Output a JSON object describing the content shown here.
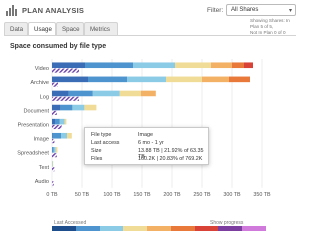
{
  "header": {
    "title": "PLAN ANALYSIS",
    "filter_label": "Filter:",
    "filter_value": "All Shares",
    "showing_line1": "Showing Shares: In Plan 5 of 5,",
    "showing_line2": "Not In Plan 0 of 0"
  },
  "tabs": [
    {
      "label": "Data"
    },
    {
      "label": "Usage"
    },
    {
      "label": "Space"
    },
    {
      "label": "Metrics"
    }
  ],
  "active_tab": "Usage",
  "section_title": "Space consumed by file type",
  "tooltip": {
    "rows": [
      {
        "key": "File type",
        "value": "Image"
      },
      {
        "key": "Last access",
        "value": "6 mo - 1 yr"
      },
      {
        "key": "Size",
        "value": "13.88 TB | 21.92% of 63.35 TB"
      },
      {
        "key": "Files",
        "value": "160.2K | 20.83% of 769.2K"
      }
    ]
  },
  "legend": {
    "left_label": "Last Accessed",
    "right_label": "Show progress",
    "colors": [
      "#1f4e8c",
      "#4e94cf",
      "#8ccbe6",
      "#f0dc96",
      "#f3b165",
      "#e8793b",
      "#d94237",
      "#7c3fa0",
      "#d07adb"
    ]
  },
  "chart_data": {
    "type": "bar",
    "orientation": "horizontal",
    "stacked": true,
    "categories": [
      "Video",
      "Archive",
      "Log",
      "Document",
      "Presentation",
      "Image",
      "Spreadsheet",
      "Text",
      "Audio"
    ],
    "x_ticks": [
      "0 TB",
      "50 TB",
      "100 TB",
      "150 TB",
      "200 TB",
      "250 TB",
      "300 TB",
      "350 TB"
    ],
    "x_range": [
      0,
      350
    ],
    "segment_colors": [
      "#3a6db5",
      "#4e94cf",
      "#8ccbe6",
      "#f0dc96",
      "#f3b165",
      "#e8793b",
      "#d94237"
    ],
    "series": [
      {
        "values": [
          55,
          60,
          28,
          14,
          5,
          1,
          0,
          0,
          0
        ]
      },
      {
        "values": [
          80,
          65,
          40,
          20,
          8,
          14,
          3,
          0,
          0
        ]
      },
      {
        "values": [
          70,
          65,
          45,
          20,
          8,
          10,
          3,
          1,
          0
        ]
      },
      {
        "values": [
          60,
          60,
          35,
          20,
          3,
          8,
          3,
          1,
          0
        ]
      },
      {
        "values": [
          35,
          45,
          25,
          0,
          0,
          0,
          0,
          0,
          0
        ]
      },
      {
        "values": [
          20,
          35,
          0,
          0,
          0,
          0,
          0,
          0,
          0
        ]
      },
      {
        "values": [
          15,
          0,
          0,
          0,
          0,
          0,
          0,
          0,
          0
        ]
      }
    ],
    "hatched_overlay": [
      {
        "category": "Video",
        "value": 45
      },
      {
        "category": "Archive",
        "value": 10
      },
      {
        "category": "Log",
        "value": 45
      },
      {
        "category": "Document",
        "value": 8
      },
      {
        "category": "Presentation",
        "value": 16
      },
      {
        "category": "Image",
        "value": 4
      },
      {
        "category": "Spreadsheet",
        "value": 8
      },
      {
        "category": "Text",
        "value": 4
      },
      {
        "category": "Audio",
        "value": 3
      }
    ],
    "xlabel": "",
    "ylabel": "",
    "grid": true
  }
}
